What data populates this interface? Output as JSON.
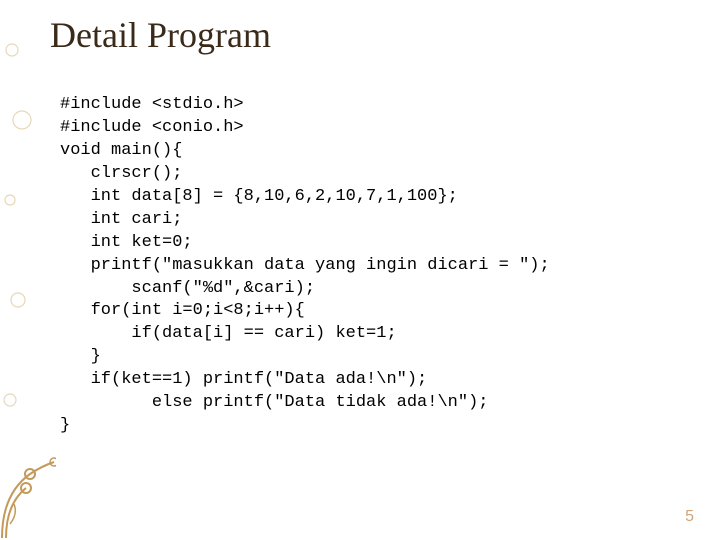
{
  "title": "Detail Program",
  "code": {
    "l1": "#include <stdio.h>",
    "l2": "#include <conio.h>",
    "l3": "void main(){",
    "l4": "   clrscr();",
    "l5": "   int data[8] = {8,10,6,2,10,7,1,100};",
    "l6": "   int cari;",
    "l7": "   int ket=0;",
    "l8": "   printf(\"masukkan data yang ingin dicari = \");",
    "l9": "       scanf(\"%d\",&cari);",
    "l10": "   for(int i=0;i<8;i++){",
    "l11": "       if(data[i] == cari) ket=1;",
    "l12": "   }",
    "l13": "   if(ket==1) printf(\"Data ada!\\n\");",
    "l14": "         else printf(\"Data tidak ada!\\n\");",
    "l15": "}"
  },
  "pagenum": "5"
}
